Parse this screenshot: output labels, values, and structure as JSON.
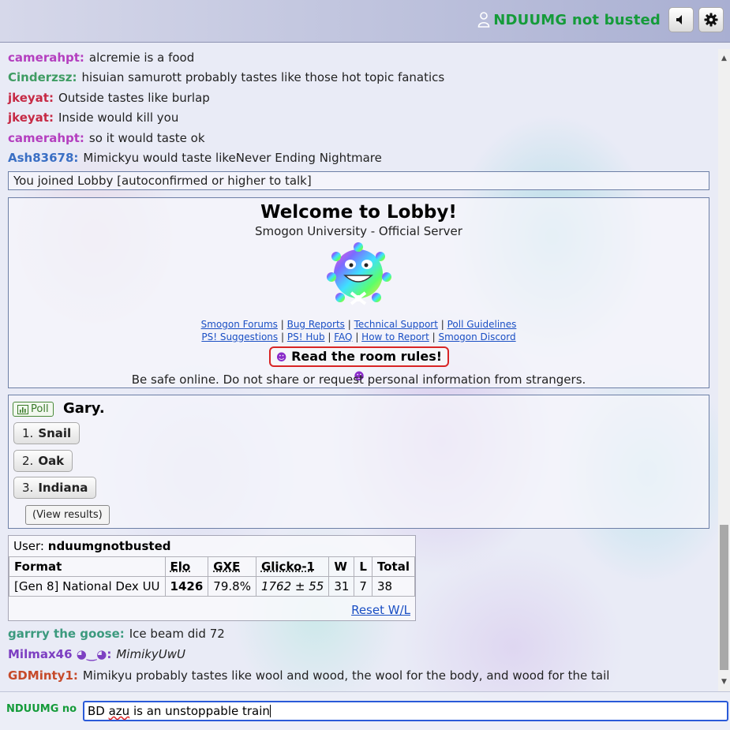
{
  "header": {
    "username": "NDUUMG not busted",
    "user_icon": "user-icon",
    "sound_icon": "speaker-icon",
    "settings_icon": "gear-icon"
  },
  "chat": {
    "messages": [
      {
        "user": "camerahpt:",
        "text": "alcremie is a food",
        "color": "#b43fbf"
      },
      {
        "user": "Cinderzsz:",
        "text": "hisuian samurott probably tastes like those hot topic fanatics",
        "color": "#3f9c63"
      },
      {
        "user": "jkeyat:",
        "text": "Outside tastes like burlap",
        "color": "#c62a45"
      },
      {
        "user": "jkeyat:",
        "text": "Inside would kill you",
        "color": "#c62a45"
      },
      {
        "user": "camerahpt:",
        "text": "so it would taste ok",
        "color": "#b43fbf"
      },
      {
        "user": "Ash83678:",
        "text": "Mimickyu would taste likeNever Ending Nightmare",
        "color": "#3a6fc4"
      }
    ],
    "join_notice": "You joined Lobby [autoconfirmed or higher to talk]",
    "later_messages": [
      {
        "user": "garrry the goose:",
        "text": "Ice beam did 72",
        "color": "#3c9a7e"
      },
      {
        "user": "Milmax46 ◕‿◕:",
        "text": "MimikyUwU",
        "color": "#7d3fc2"
      },
      {
        "user": "GDMinty1:",
        "text": "Mimikyu probably tastes like wool and wood, the wool for the body, and wood for the tail",
        "color": "#c64a2a"
      }
    ]
  },
  "welcome": {
    "title": "Welcome to Lobby!",
    "subtitle": "Smogon University - Official Server",
    "image_icon": "koffing-icon",
    "links_row1": [
      "Smogon Forums",
      "Bug Reports",
      "Technical Support",
      "Poll Guidelines"
    ],
    "links_row2": [
      "PS! Suggestions",
      "PS! Hub",
      "FAQ",
      "How to Report",
      "Smogon Discord"
    ],
    "rules_button": "Read the room rules!",
    "rules_glyph": "☻",
    "safety_note": "Be safe online. Do not share or request personal information from strangers."
  },
  "poll": {
    "badge": "Poll",
    "question": "Gary.",
    "options": [
      {
        "num": "1.",
        "label": "Snail"
      },
      {
        "num": "2.",
        "label": "Oak"
      },
      {
        "num": "3.",
        "label": "Indiana"
      }
    ],
    "view_results": "(View results)"
  },
  "stats": {
    "user_label": "User:",
    "user_name": "nduumgnotbusted",
    "headers": [
      "Format",
      "Elo",
      "GXE",
      "Glicko-1",
      "W",
      "L",
      "Total"
    ],
    "row": {
      "format": "[Gen 8] National Dex UU",
      "elo": "1426",
      "gxe": "79.8%",
      "glicko": "1762 ± 55",
      "w": "31",
      "l": "7",
      "total": "38"
    },
    "reset": "Reset W/L"
  },
  "input": {
    "prefix": "NDUUMG no",
    "value_pre": "BD ",
    "value_misspelled": "azu",
    "value_post": " is an unstoppable train"
  }
}
